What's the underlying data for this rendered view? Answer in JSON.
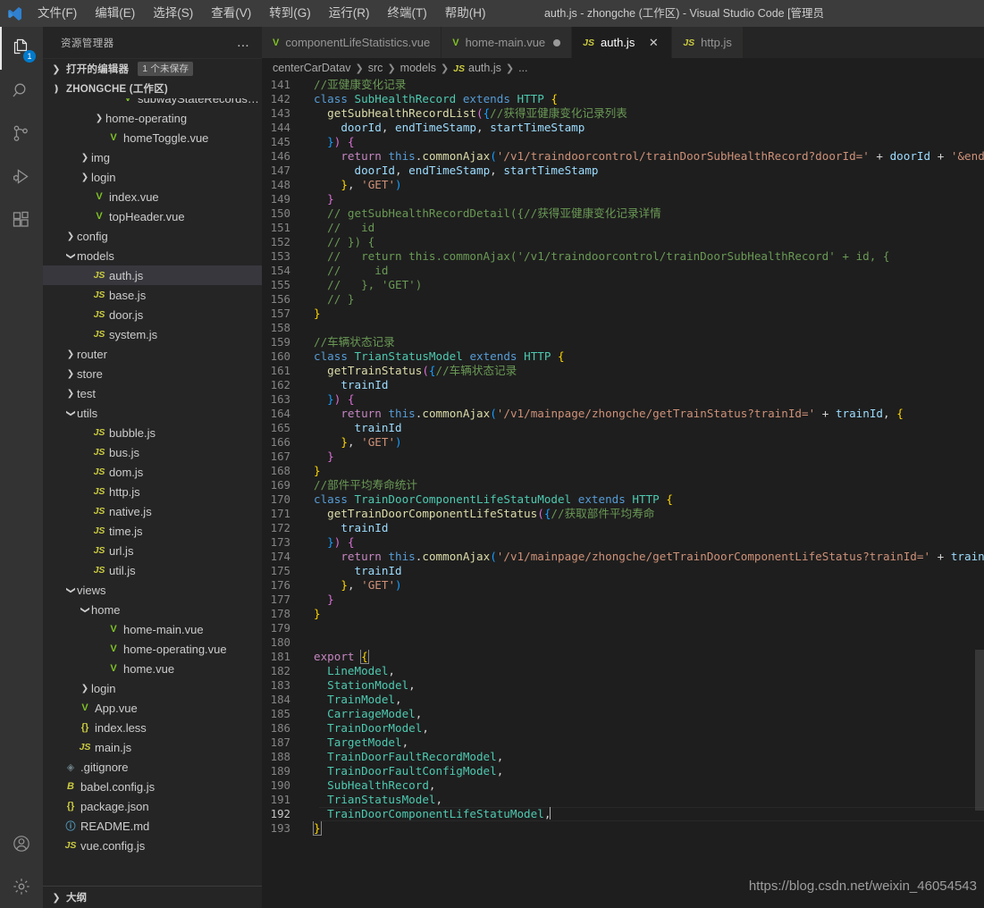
{
  "window": {
    "title": "auth.js - zhongche (工作区) - Visual Studio Code [管理员",
    "logo_icon": "vscode-logo-icon"
  },
  "menu": {
    "items": [
      {
        "label": "文件(F)",
        "name": "menu-file"
      },
      {
        "label": "编辑(E)",
        "name": "menu-edit"
      },
      {
        "label": "选择(S)",
        "name": "menu-selection"
      },
      {
        "label": "查看(V)",
        "name": "menu-view"
      },
      {
        "label": "转到(G)",
        "name": "menu-go"
      },
      {
        "label": "运行(R)",
        "name": "menu-run"
      },
      {
        "label": "终端(T)",
        "name": "menu-terminal"
      },
      {
        "label": "帮助(H)",
        "name": "menu-help"
      }
    ]
  },
  "activitybar": {
    "items": [
      {
        "name": "explorer-icon",
        "badge": "1",
        "active": true
      },
      {
        "name": "search-icon",
        "badge": "",
        "active": false
      },
      {
        "name": "source-control-icon",
        "badge": "",
        "active": false
      },
      {
        "name": "run-and-debug-icon",
        "badge": "",
        "active": false
      },
      {
        "name": "extensions-icon",
        "badge": "",
        "active": false
      }
    ],
    "bottom": [
      {
        "name": "account-icon"
      },
      {
        "name": "settings-gear-icon"
      }
    ]
  },
  "sidebar": {
    "header_title": "资源管理器",
    "more_actions": "...",
    "open_editors": {
      "label": "打开的编辑器",
      "badge": "1 个未保存"
    },
    "workspace": {
      "label": "ZHONGCHE (工作区)"
    },
    "outline": {
      "label": "大纲"
    },
    "tree": [
      {
        "name": "subwayStateRecords.vue",
        "indent": 4,
        "icon": "vue",
        "arrow": "",
        "selected": false
      },
      {
        "name": "home-operating",
        "indent": 3,
        "icon": "",
        "arrow": "collapsed",
        "selected": false
      },
      {
        "name": "homeToggle.vue",
        "indent": 3,
        "icon": "vue",
        "arrow": "",
        "selected": false
      },
      {
        "name": "img",
        "indent": 2,
        "icon": "",
        "arrow": "collapsed",
        "selected": false
      },
      {
        "name": "login",
        "indent": 2,
        "icon": "",
        "arrow": "collapsed",
        "selected": false
      },
      {
        "name": "index.vue",
        "indent": 2,
        "icon": "vue",
        "arrow": "",
        "selected": false
      },
      {
        "name": "topHeader.vue",
        "indent": 2,
        "icon": "vue",
        "arrow": "",
        "selected": false
      },
      {
        "name": "config",
        "indent": 1,
        "icon": "",
        "arrow": "collapsed",
        "selected": false
      },
      {
        "name": "models",
        "indent": 1,
        "icon": "",
        "arrow": "expanded",
        "selected": false
      },
      {
        "name": "auth.js",
        "indent": 2,
        "icon": "js",
        "arrow": "",
        "selected": true
      },
      {
        "name": "base.js",
        "indent": 2,
        "icon": "js",
        "arrow": "",
        "selected": false
      },
      {
        "name": "door.js",
        "indent": 2,
        "icon": "js",
        "arrow": "",
        "selected": false
      },
      {
        "name": "system.js",
        "indent": 2,
        "icon": "js",
        "arrow": "",
        "selected": false
      },
      {
        "name": "router",
        "indent": 1,
        "icon": "",
        "arrow": "collapsed",
        "selected": false
      },
      {
        "name": "store",
        "indent": 1,
        "icon": "",
        "arrow": "collapsed",
        "selected": false
      },
      {
        "name": "test",
        "indent": 1,
        "icon": "",
        "arrow": "collapsed",
        "selected": false
      },
      {
        "name": "utils",
        "indent": 1,
        "icon": "",
        "arrow": "expanded",
        "selected": false
      },
      {
        "name": "bubble.js",
        "indent": 2,
        "icon": "js",
        "arrow": "",
        "selected": false
      },
      {
        "name": "bus.js",
        "indent": 2,
        "icon": "js",
        "arrow": "",
        "selected": false
      },
      {
        "name": "dom.js",
        "indent": 2,
        "icon": "js",
        "arrow": "",
        "selected": false
      },
      {
        "name": "http.js",
        "indent": 2,
        "icon": "js",
        "arrow": "",
        "selected": false
      },
      {
        "name": "native.js",
        "indent": 2,
        "icon": "js",
        "arrow": "",
        "selected": false
      },
      {
        "name": "time.js",
        "indent": 2,
        "icon": "js",
        "arrow": "",
        "selected": false
      },
      {
        "name": "url.js",
        "indent": 2,
        "icon": "js",
        "arrow": "",
        "selected": false
      },
      {
        "name": "util.js",
        "indent": 2,
        "icon": "js",
        "arrow": "",
        "selected": false
      },
      {
        "name": "views",
        "indent": 1,
        "icon": "",
        "arrow": "expanded",
        "selected": false
      },
      {
        "name": "home",
        "indent": 2,
        "icon": "",
        "arrow": "expanded",
        "selected": false
      },
      {
        "name": "home-main.vue",
        "indent": 3,
        "icon": "vue",
        "arrow": "",
        "selected": false
      },
      {
        "name": "home-operating.vue",
        "indent": 3,
        "icon": "vue",
        "arrow": "",
        "selected": false
      },
      {
        "name": "home.vue",
        "indent": 3,
        "icon": "vue",
        "arrow": "",
        "selected": false
      },
      {
        "name": "login",
        "indent": 2,
        "icon": "",
        "arrow": "collapsed",
        "selected": false
      },
      {
        "name": "App.vue",
        "indent": 1,
        "icon": "vue",
        "arrow": "",
        "selected": false
      },
      {
        "name": "index.less",
        "indent": 1,
        "icon": "json",
        "arrow": "",
        "selected": false
      },
      {
        "name": "main.js",
        "indent": 1,
        "icon": "js",
        "arrow": "",
        "selected": false
      },
      {
        "name": ".gitignore",
        "indent": 0,
        "icon": "git",
        "arrow": "",
        "selected": false
      },
      {
        "name": "babel.config.js",
        "indent": 0,
        "icon": "babel",
        "arrow": "",
        "selected": false
      },
      {
        "name": "package.json",
        "indent": 0,
        "icon": "json",
        "arrow": "",
        "selected": false
      },
      {
        "name": "README.md",
        "indent": 0,
        "icon": "md",
        "arrow": "",
        "selected": false
      },
      {
        "name": "vue.config.js",
        "indent": 0,
        "icon": "js",
        "arrow": "",
        "selected": false
      }
    ]
  },
  "tabs": [
    {
      "label": "componentLifeStatistics.vue",
      "icon": "vue",
      "active": false,
      "dirty": false,
      "closable": false
    },
    {
      "label": "home-main.vue",
      "icon": "vue",
      "active": false,
      "dirty": true,
      "closable": false
    },
    {
      "label": "auth.js",
      "icon": "js",
      "active": true,
      "dirty": false,
      "closable": true
    },
    {
      "label": "http.js",
      "icon": "js",
      "active": false,
      "dirty": false,
      "closable": false
    }
  ],
  "breadcrumb": [
    {
      "label": "centerCarDatav",
      "icon": ""
    },
    {
      "label": "src",
      "icon": ""
    },
    {
      "label": "models",
      "icon": ""
    },
    {
      "label": "auth.js",
      "icon": "js"
    },
    {
      "label": "...",
      "icon": ""
    }
  ],
  "editor": {
    "first_line": 141,
    "current_line": 192,
    "watermark": "https://blog.csdn.net/weixin_46054543",
    "lines": [
      {
        "n": 141,
        "html": "<span class=\"t-cmt\">//亚健康变化记录</span>"
      },
      {
        "n": 142,
        "html": "<span class=\"t-kw\">class</span> <span class=\"t-cls\">SubHealthRecord</span> <span class=\"t-kw\">extends</span> <span class=\"t-cls\">HTTP</span> <span class=\"t-b1\">{</span>"
      },
      {
        "n": 143,
        "html": "  <span class=\"t-fn\">getSubHealthRecordList</span><span class=\"t-b2\">(</span><span class=\"t-b3\">{</span><span class=\"t-cmt\">//获得亚健康变化记录列表</span>"
      },
      {
        "n": 144,
        "html": "    <span class=\"t-var\">doorId</span>, <span class=\"t-var\">endTimeStamp</span>, <span class=\"t-var\">startTimeStamp</span>"
      },
      {
        "n": 145,
        "html": "  <span class=\"t-b3\">}</span><span class=\"t-b2\">)</span> <span class=\"t-b2\">{</span>"
      },
      {
        "n": 146,
        "html": "    <span class=\"t-kw2\">return</span> <span class=\"t-kw\">this</span>.<span class=\"t-fn\">commonAjax</span><span class=\"t-b3\">(</span><span class=\"t-str\">'/v1/traindoorcontrol/trainDoorSubHealthRecord?doorId='</span> <span class=\"t-op\">+</span> <span class=\"t-var\">doorId</span> <span class=\"t-op\">+</span> <span class=\"t-str\">'&amp;endTimeStamp='</span> <span class=\"t-op\">+</span>"
      },
      {
        "n": 147,
        "html": "      <span class=\"t-var\">doorId</span>, <span class=\"t-var\">endTimeStamp</span>, <span class=\"t-var\">startTimeStamp</span>"
      },
      {
        "n": 148,
        "html": "    <span class=\"t-b1\">}</span>, <span class=\"t-str\">'GET'</span><span class=\"t-b3\">)</span>"
      },
      {
        "n": 149,
        "html": "  <span class=\"t-b2\">}</span>"
      },
      {
        "n": 150,
        "html": "  <span class=\"t-cmt\">// getSubHealthRecordDetail({//获得亚健康变化记录详情</span>"
      },
      {
        "n": 151,
        "html": "  <span class=\"t-cmt\">//   id</span>"
      },
      {
        "n": 152,
        "html": "  <span class=\"t-cmt\">// }) {</span>"
      },
      {
        "n": 153,
        "html": "  <span class=\"t-cmt\">//   return this.commonAjax('/v1/traindoorcontrol/trainDoorSubHealthRecord' + id, {</span>"
      },
      {
        "n": 154,
        "html": "  <span class=\"t-cmt\">//     id</span>"
      },
      {
        "n": 155,
        "html": "  <span class=\"t-cmt\">//   }, 'GET')</span>"
      },
      {
        "n": 156,
        "html": "  <span class=\"t-cmt\">// }</span>"
      },
      {
        "n": 157,
        "html": "<span class=\"t-b1\">}</span>"
      },
      {
        "n": 158,
        "html": ""
      },
      {
        "n": 159,
        "html": "<span class=\"t-cmt\">//车辆状态记录</span>"
      },
      {
        "n": 160,
        "html": "<span class=\"t-kw\">class</span> <span class=\"t-cls\">TrianStatusModel</span> <span class=\"t-kw\">extends</span> <span class=\"t-cls\">HTTP</span> <span class=\"t-b1\">{</span>"
      },
      {
        "n": 161,
        "html": "  <span class=\"t-fn\">getTrainStatus</span><span class=\"t-b2\">(</span><span class=\"t-b3\">{</span><span class=\"t-cmt\">//车辆状态记录</span>"
      },
      {
        "n": 162,
        "html": "    <span class=\"t-var\">trainId</span>"
      },
      {
        "n": 163,
        "html": "  <span class=\"t-b3\">}</span><span class=\"t-b2\">)</span> <span class=\"t-b2\">{</span>"
      },
      {
        "n": 164,
        "html": "    <span class=\"t-kw2\">return</span> <span class=\"t-kw\">this</span>.<span class=\"t-fn\">commonAjax</span><span class=\"t-b3\">(</span><span class=\"t-str\">'/v1/mainpage/zhongche/getTrainStatus?trainId='</span> <span class=\"t-op\">+</span> <span class=\"t-var\">trainId</span>, <span class=\"t-b1\">{</span>"
      },
      {
        "n": 165,
        "html": "      <span class=\"t-var\">trainId</span>"
      },
      {
        "n": 166,
        "html": "    <span class=\"t-b1\">}</span>, <span class=\"t-str\">'GET'</span><span class=\"t-b3\">)</span>"
      },
      {
        "n": 167,
        "html": "  <span class=\"t-b2\">}</span>"
      },
      {
        "n": 168,
        "html": "<span class=\"t-b1\">}</span>"
      },
      {
        "n": 169,
        "html": "<span class=\"t-cmt\">//部件平均寿命统计</span>"
      },
      {
        "n": 170,
        "html": "<span class=\"t-kw\">class</span> <span class=\"t-cls\">TrainDoorComponentLifeStatuModel</span> <span class=\"t-kw\">extends</span> <span class=\"t-cls\">HTTP</span> <span class=\"t-b1\">{</span>"
      },
      {
        "n": 171,
        "html": "  <span class=\"t-fn\">getTrainDoorComponentLifeStatus</span><span class=\"t-b2\">(</span><span class=\"t-b3\">{</span><span class=\"t-cmt\">//获取部件平均寿命</span>"
      },
      {
        "n": 172,
        "html": "    <span class=\"t-var\">trainId</span>"
      },
      {
        "n": 173,
        "html": "  <span class=\"t-b3\">}</span><span class=\"t-b2\">)</span> <span class=\"t-b2\">{</span>"
      },
      {
        "n": 174,
        "html": "    <span class=\"t-kw2\">return</span> <span class=\"t-kw\">this</span>.<span class=\"t-fn\">commonAjax</span><span class=\"t-b3\">(</span><span class=\"t-str\">'/v1/mainpage/zhongche/getTrainDoorComponentLifeStatus?trainId='</span> <span class=\"t-op\">+</span> <span class=\"t-var\">trainId</span>, <span class=\"t-b1\">{</span>"
      },
      {
        "n": 175,
        "html": "      <span class=\"t-var\">trainId</span>"
      },
      {
        "n": 176,
        "html": "    <span class=\"t-b1\">}</span>, <span class=\"t-str\">'GET'</span><span class=\"t-b3\">)</span>"
      },
      {
        "n": 177,
        "html": "  <span class=\"t-b2\">}</span>"
      },
      {
        "n": 178,
        "html": "<span class=\"t-b1\">}</span>"
      },
      {
        "n": 179,
        "html": ""
      },
      {
        "n": 180,
        "html": ""
      },
      {
        "n": 181,
        "html": "<span class=\"t-kw2\">export</span> <span class=\"t-b1 bracket-box\">{</span>"
      },
      {
        "n": 182,
        "html": "  <span class=\"t-cls\">LineModel</span>,"
      },
      {
        "n": 183,
        "html": "  <span class=\"t-cls\">StationModel</span>,"
      },
      {
        "n": 184,
        "html": "  <span class=\"t-cls\">TrainModel</span>,"
      },
      {
        "n": 185,
        "html": "  <span class=\"t-cls\">CarriageModel</span>,"
      },
      {
        "n": 186,
        "html": "  <span class=\"t-cls\">TrainDoorModel</span>,"
      },
      {
        "n": 187,
        "html": "  <span class=\"t-cls\">TargetModel</span>,"
      },
      {
        "n": 188,
        "html": "  <span class=\"t-cls\">TrainDoorFaultRecordModel</span>,"
      },
      {
        "n": 189,
        "html": "  <span class=\"t-cls\">TrainDoorFaultConfigModel</span>,"
      },
      {
        "n": 190,
        "html": "  <span class=\"t-cls\">SubHealthRecord</span>,"
      },
      {
        "n": 191,
        "html": "  <span class=\"t-cls\">TrianStatusModel</span>,"
      },
      {
        "n": 192,
        "html": "  <span class=\"t-cls\">TrainDoorComponentLifeStatuModel</span>,<span class=\"cursor\"></span>"
      },
      {
        "n": 193,
        "html": "<span class=\"t-b1 bracket-box\">}</span>"
      }
    ]
  },
  "colors": {
    "accent": "#007acc",
    "editor_bg": "#1e1e1e",
    "sidebar_bg": "#252526",
    "titlebar_bg": "#3c3c3c",
    "activitybar_bg": "#333333"
  }
}
